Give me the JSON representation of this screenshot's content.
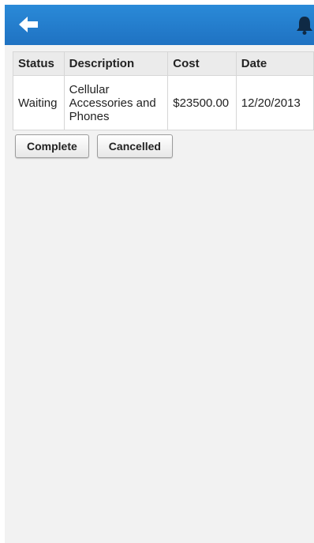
{
  "header": {
    "back_icon": "back-arrow-icon",
    "notification_icon": "bell-icon",
    "background_color": "#2280cf"
  },
  "table": {
    "columns": [
      "Status",
      "Description",
      "Cost",
      "Date"
    ],
    "rows": [
      {
        "status": "Waiting",
        "description": "Cellular Accessories and Phones",
        "cost": "$23500.00",
        "date": "12/20/2013"
      }
    ]
  },
  "actions": {
    "complete_label": "Complete",
    "cancelled_label": "Cancelled"
  }
}
